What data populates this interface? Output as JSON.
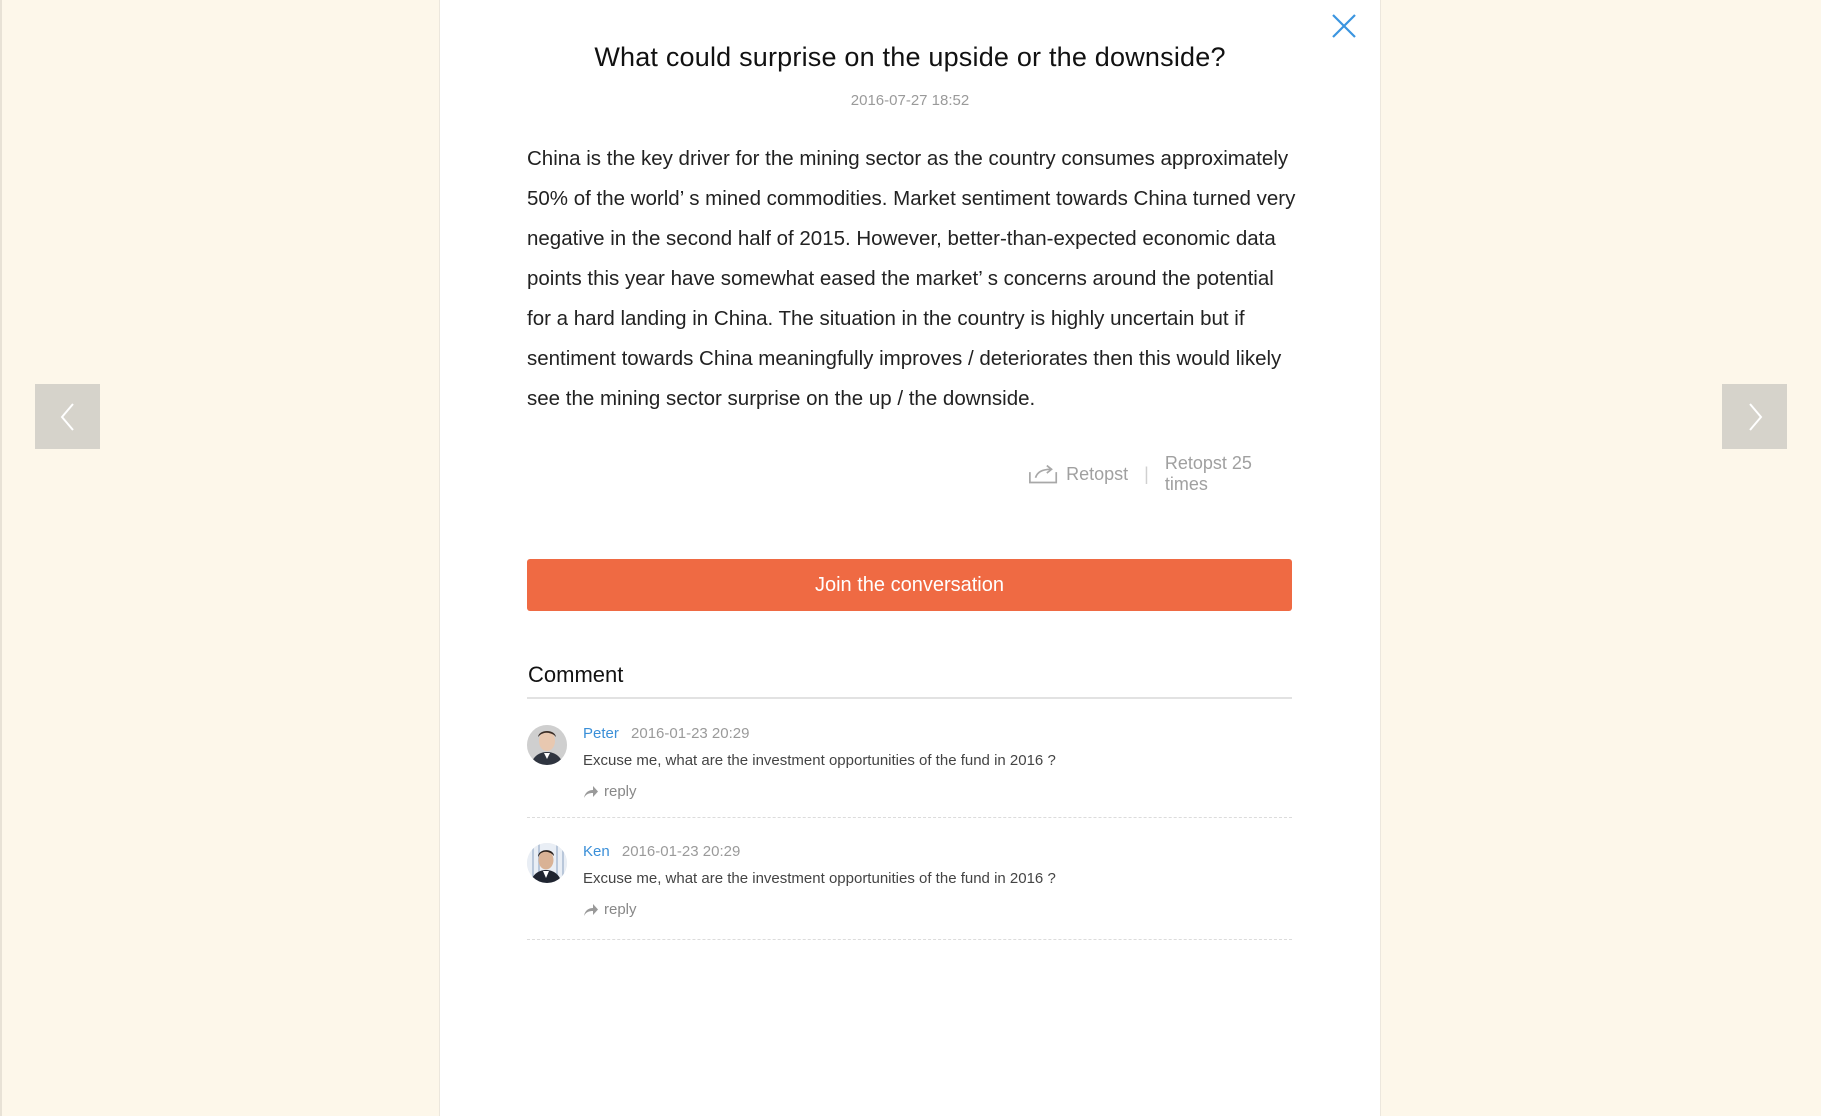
{
  "article": {
    "title": "What could surprise on the upside or the downside?",
    "date": "2016-07-27 18:52",
    "body": "China is the key driver for the mining sector as the country consumes approximately 50% of the world’ s mined commodities. Market sentiment towards China turned very negative in the second half of 2015. However, better-than-expected economic data points this year have somewhat eased the market’ s concerns around the potential for a hard landing in China. The situation in the country is highly uncertain but if sentiment towards China meaningfully improves / deteriorates then this would likely see the mining sector surprise on the up / the downside."
  },
  "share": {
    "icon": "share-icon",
    "retopst_label": "Retopst",
    "separator": "|",
    "count_text": "Retopst 25 times"
  },
  "join_button": "Join the conversation",
  "comments_section": {
    "heading": "Comment",
    "items": [
      {
        "name": "Peter",
        "time": "2016-01-23 20:29",
        "text": "Excuse me, what are the investment opportunities of the fund in 2016 ?",
        "reply_label": "reply",
        "avatar": "avatar-peter"
      },
      {
        "name": "Ken",
        "time": "2016-01-23 20:29",
        "text": "Excuse me, what are the investment opportunities of the fund in 2016 ?",
        "reply_label": "reply",
        "avatar": "avatar-ken"
      }
    ]
  },
  "navigation": {
    "prev_icon": "chevron-left-icon",
    "next_icon": "chevron-right-icon",
    "close_icon": "close-icon"
  },
  "colors": {
    "page_background": "#fdf7ea",
    "accent_orange": "#ef6a43",
    "link_blue": "#3a8fd8",
    "close_blue": "#3b95e0",
    "nav_gray": "#d6d3cb"
  }
}
